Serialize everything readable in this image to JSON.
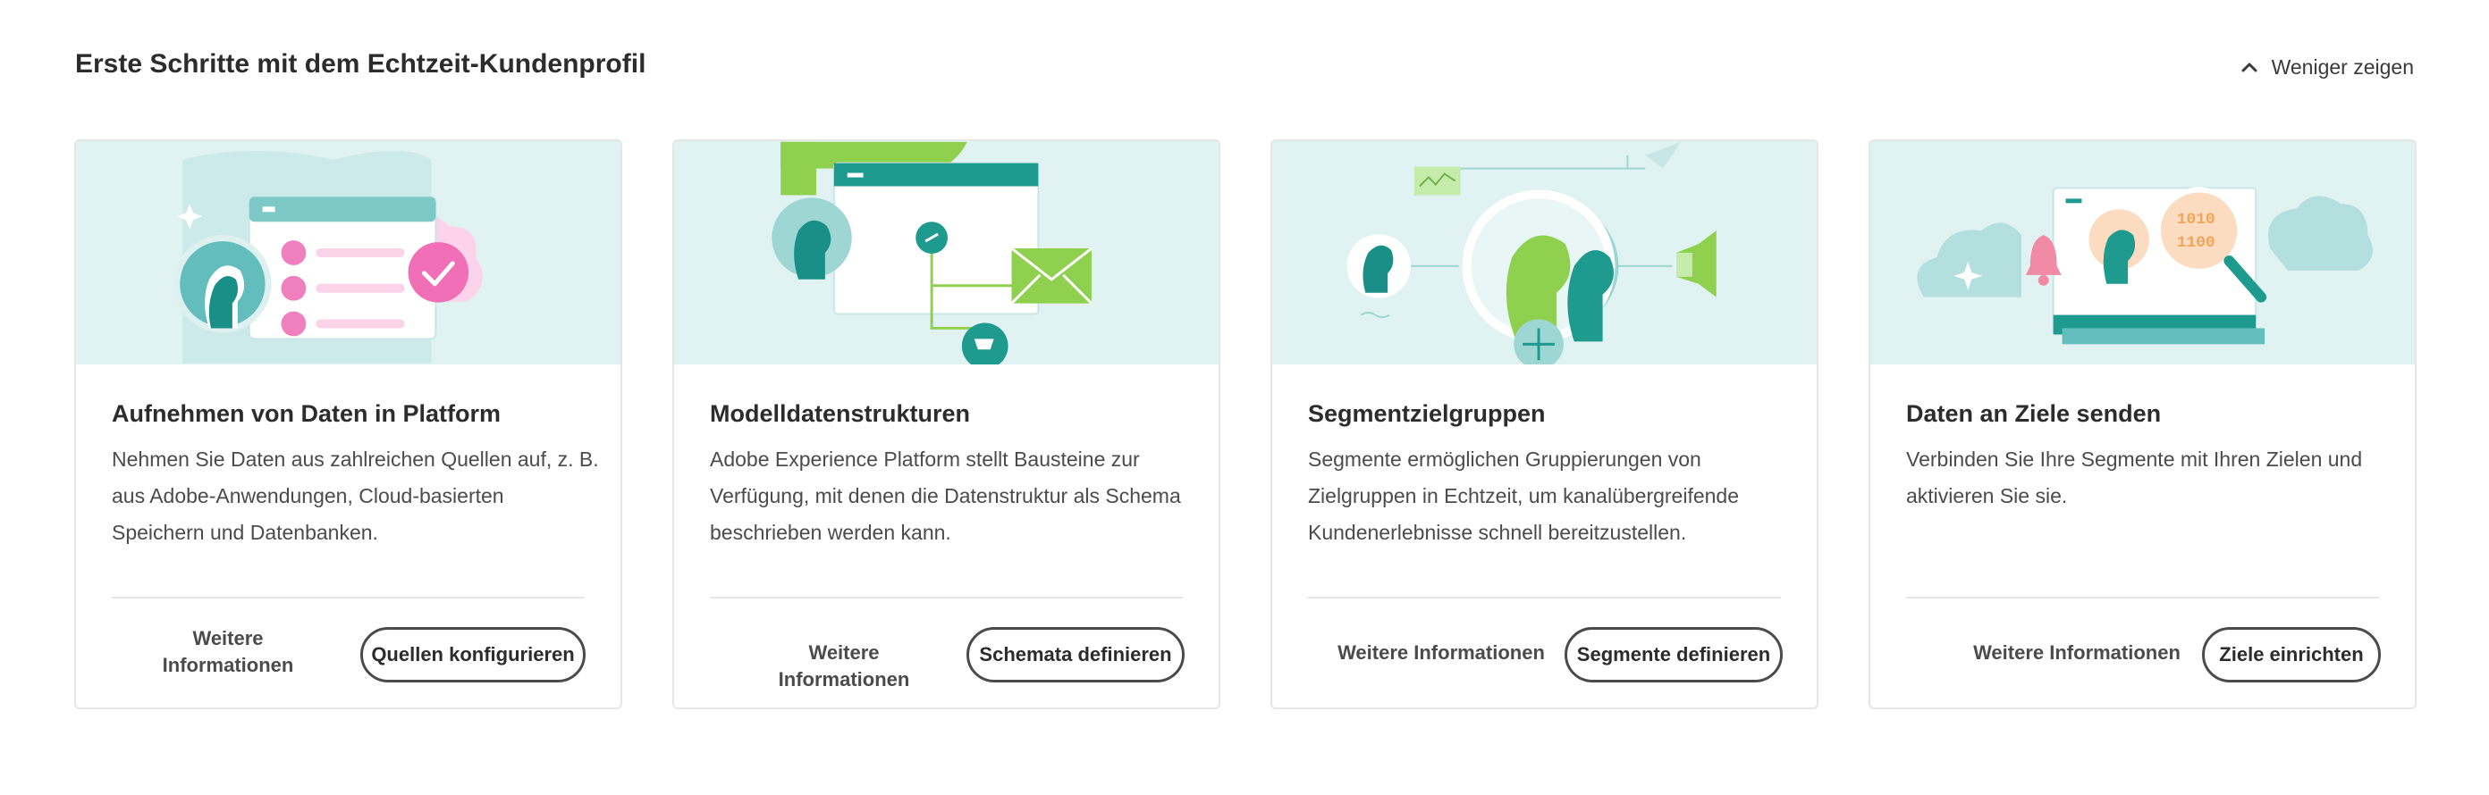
{
  "header": {
    "title": "Erste Schritte mit dem Echtzeit-Kundenprofil",
    "toggle_label": "Weniger zeigen",
    "toggle_icon": "chevron-up-icon"
  },
  "colors": {
    "accent_green": "#8fd14f",
    "teal": "#1f9a8f",
    "pink": "#f06fb6",
    "illustration_bg": "#e1f2f2"
  },
  "cards": [
    {
      "title": "Aufnehmen von Daten in Platform",
      "description": "Nehmen Sie Daten aus zahlreichen Quellen auf, z. B. aus Adobe-Anwendungen, Cloud-basierten Speichern und Datenbanken.",
      "secondary_label": "Weitere Informationen",
      "primary_label": "Quellen konfigurieren"
    },
    {
      "title": "Modelldatenstrukturen",
      "description": "Adobe Experience Platform stellt Bausteine zur Verfügung, mit denen die Datenstruktur als Schema beschrieben werden kann.",
      "secondary_label": "Weitere Informationen",
      "primary_label": "Schemata definieren"
    },
    {
      "title": "Segmentzielgruppen",
      "description": "Segmente ermöglichen Gruppierungen von Zielgruppen in Echtzeit, um kanalübergreifende Kundenerlebnisse schnell bereitzustellen.",
      "secondary_label": "Weitere Informationen",
      "primary_label": "Segmente definieren"
    },
    {
      "title": "Daten an Ziele senden",
      "description": "Verbinden Sie Ihre Segmente mit Ihren Zielen und aktivieren Sie sie.",
      "secondary_label": "Weitere Informationen",
      "primary_label": "Ziele einrichten"
    }
  ]
}
